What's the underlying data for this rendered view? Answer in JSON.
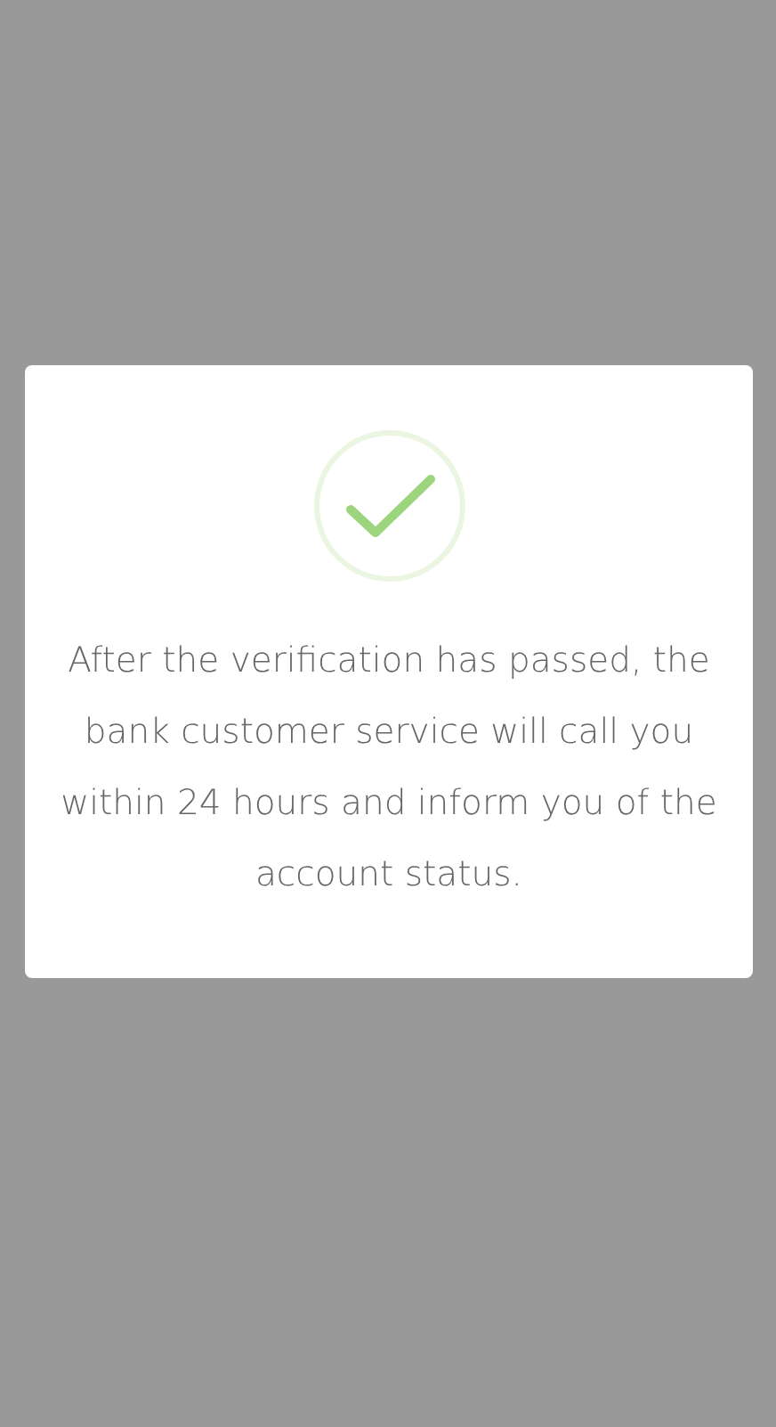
{
  "dialog": {
    "message": "After the verification has passed, the bank customer service will call you within 24 hours and inform you of the account status."
  }
}
